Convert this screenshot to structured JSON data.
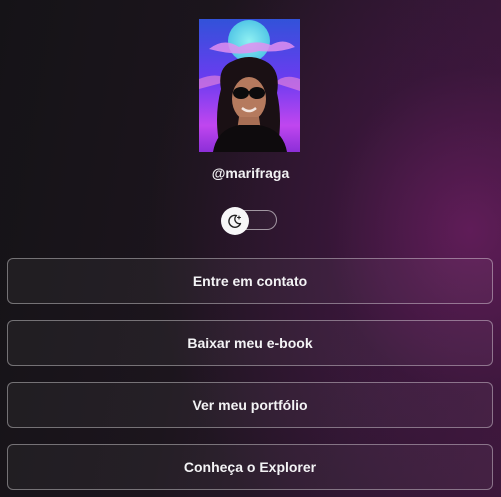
{
  "profile": {
    "username": "@marifraga",
    "avatar_alt": "profile-photo"
  },
  "theme_toggle": {
    "icon": "moon-stars-icon"
  },
  "links": [
    {
      "label": "Entre em contato"
    },
    {
      "label": "Baixar meu e-book"
    },
    {
      "label": "Ver meu portfólio"
    },
    {
      "label": "Conheça o Explorer"
    }
  ],
  "colors": {
    "background_dark": "#151317",
    "background_accent": "#3a1838",
    "button_border": "#a9a3ab",
    "text": "#f4f4f5"
  }
}
